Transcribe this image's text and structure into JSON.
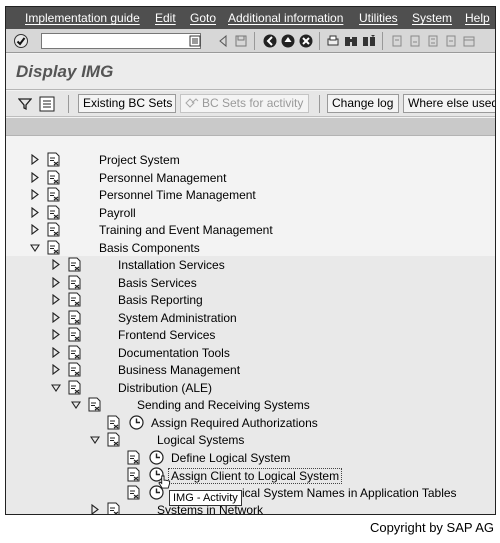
{
  "menu": [
    {
      "label": "Implementation guide"
    },
    {
      "label": "Edit"
    },
    {
      "label": "Goto"
    },
    {
      "label": "Additional information"
    },
    {
      "label": "Utilities"
    },
    {
      "label": "System"
    },
    {
      "label": "Help"
    }
  ],
  "screen_title": "Display IMG",
  "app_toolbar": {
    "existing_bc_sets": "Existing BC Sets",
    "bc_sets_for_activity": "BC Sets for activity",
    "change_log": "Change log",
    "where_else_used": "Where else used"
  },
  "tree": [
    {
      "label": "Project System",
      "level": 0,
      "expanded": false
    },
    {
      "label": "Personnel Management",
      "level": 0,
      "expanded": false
    },
    {
      "label": "Personnel Time Management",
      "level": 0,
      "expanded": false
    },
    {
      "label": "Payroll",
      "level": 0,
      "expanded": false
    },
    {
      "label": "Training and Event Management",
      "level": 0,
      "expanded": false
    },
    {
      "label": "Basis Components",
      "level": 0,
      "expanded": true
    },
    {
      "label": "Installation Services",
      "level": 1,
      "expanded": false
    },
    {
      "label": "Basis Services",
      "level": 1,
      "expanded": false
    },
    {
      "label": "Basis Reporting",
      "level": 1,
      "expanded": false
    },
    {
      "label": "System Administration",
      "level": 1,
      "expanded": false
    },
    {
      "label": "Frontend Services",
      "level": 1,
      "expanded": false
    },
    {
      "label": "Documentation Tools",
      "level": 1,
      "expanded": false
    },
    {
      "label": "Business Management",
      "level": 1,
      "expanded": false
    },
    {
      "label": "Distribution (ALE)",
      "level": 1,
      "expanded": true
    },
    {
      "label": "Sending and Receiving Systems",
      "level": 2,
      "expanded": true
    },
    {
      "label": "Assign Required Authorizations",
      "level": 3,
      "activity": true
    },
    {
      "label": "Logical Systems",
      "level": 3,
      "expanded": true
    },
    {
      "label": "Define Logical System",
      "level": 4,
      "activity": true
    },
    {
      "label": "Assign Client to Logical System",
      "level": 4,
      "activity": true,
      "selected": true
    },
    {
      "label": "ical System Names in Application Tables",
      "level": 4,
      "activity": true
    },
    {
      "label": "Systems in Network",
      "level": 3,
      "expanded": false
    }
  ],
  "tooltip": "IMG - Activity",
  "copyright": "Copyright by SAP AG"
}
